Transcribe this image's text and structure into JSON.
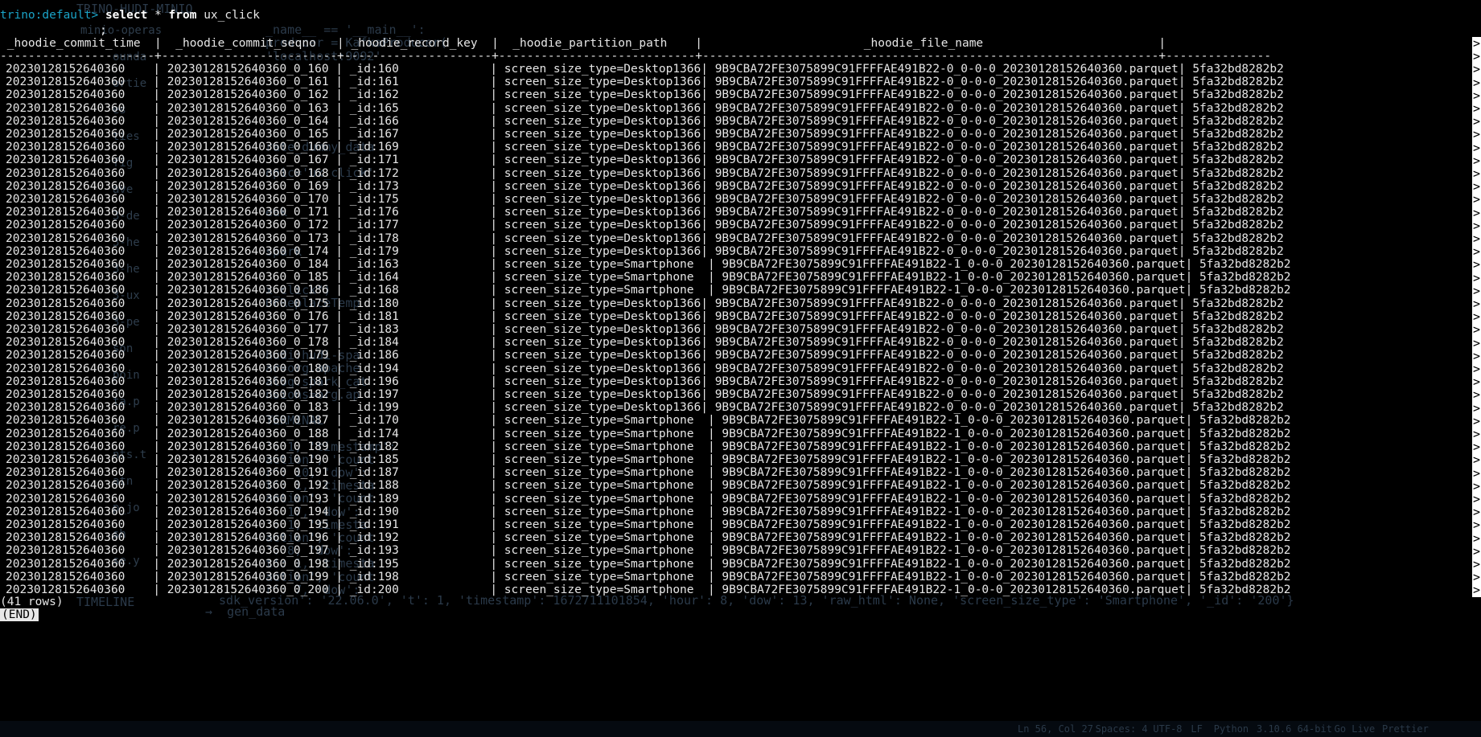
{
  "query": {
    "prompt_tag": "trino:default>",
    "keyword_select": "select",
    "rest": "* ",
    "keyword_from": "from",
    "table": "ux_click",
    "terminator": ";"
  },
  "table": {
    "header": [
      "_hoodie_commit_time",
      "_hoodie_commit_seqno",
      "_hoodie_record_key",
      "_hoodie_partition_path",
      "_hoodie_file_name"
    ],
    "header_line": " _hoodie_commit_time  |  _hoodie_commit_seqno   | _hoodie_record_key  |  _hoodie_partition_path    |                       _hoodie_file_name                         |",
    "separator_line": "----------------------+-------------------------+---------------------+----------------------------+-----------------------------------------------------------------+---------------",
    "rows": [
      [
        "20230128152640360",
        "20230128152640360_0_160",
        "_id:160",
        "screen_size_type=Desktop1366",
        "9B9CBA72FE3075899C91FFFFAE491B22-0_0-0-0_20230128152640360.parquet",
        "5fa32bd8282b2"
      ],
      [
        "20230128152640360",
        "20230128152640360_0_161",
        "_id:161",
        "screen_size_type=Desktop1366",
        "9B9CBA72FE3075899C91FFFFAE491B22-0_0-0-0_20230128152640360.parquet",
        "5fa32bd8282b2"
      ],
      [
        "20230128152640360",
        "20230128152640360_0_162",
        "_id:162",
        "screen_size_type=Desktop1366",
        "9B9CBA72FE3075899C91FFFFAE491B22-0_0-0-0_20230128152640360.parquet",
        "5fa32bd8282b2"
      ],
      [
        "20230128152640360",
        "20230128152640360_0_163",
        "_id:165",
        "screen_size_type=Desktop1366",
        "9B9CBA72FE3075899C91FFFFAE491B22-0_0-0-0_20230128152640360.parquet",
        "5fa32bd8282b2"
      ],
      [
        "20230128152640360",
        "20230128152640360_0_164",
        "_id:166",
        "screen_size_type=Desktop1366",
        "9B9CBA72FE3075899C91FFFFAE491B22-0_0-0-0_20230128152640360.parquet",
        "5fa32bd8282b2"
      ],
      [
        "20230128152640360",
        "20230128152640360_0_165",
        "_id:167",
        "screen_size_type=Desktop1366",
        "9B9CBA72FE3075899C91FFFFAE491B22-0_0-0-0_20230128152640360.parquet",
        "5fa32bd8282b2"
      ],
      [
        "20230128152640360",
        "20230128152640360_0_166",
        "_id:169",
        "screen_size_type=Desktop1366",
        "9B9CBA72FE3075899C91FFFFAE491B22-0_0-0-0_20230128152640360.parquet",
        "5fa32bd8282b2"
      ],
      [
        "20230128152640360",
        "20230128152640360_0_167",
        "_id:171",
        "screen_size_type=Desktop1366",
        "9B9CBA72FE3075899C91FFFFAE491B22-0_0-0-0_20230128152640360.parquet",
        "5fa32bd8282b2"
      ],
      [
        "20230128152640360",
        "20230128152640360_0_168",
        "_id:172",
        "screen_size_type=Desktop1366",
        "9B9CBA72FE3075899C91FFFFAE491B22-0_0-0-0_20230128152640360.parquet",
        "5fa32bd8282b2"
      ],
      [
        "20230128152640360",
        "20230128152640360_0_169",
        "_id:173",
        "screen_size_type=Desktop1366",
        "9B9CBA72FE3075899C91FFFFAE491B22-0_0-0-0_20230128152640360.parquet",
        "5fa32bd8282b2"
      ],
      [
        "20230128152640360",
        "20230128152640360_0_170",
        "_id:175",
        "screen_size_type=Desktop1366",
        "9B9CBA72FE3075899C91FFFFAE491B22-0_0-0-0_20230128152640360.parquet",
        "5fa32bd8282b2"
      ],
      [
        "20230128152640360",
        "20230128152640360_0_171",
        "_id:176",
        "screen_size_type=Desktop1366",
        "9B9CBA72FE3075899C91FFFFAE491B22-0_0-0-0_20230128152640360.parquet",
        "5fa32bd8282b2"
      ],
      [
        "20230128152640360",
        "20230128152640360_0_172",
        "_id:177",
        "screen_size_type=Desktop1366",
        "9B9CBA72FE3075899C91FFFFAE491B22-0_0-0-0_20230128152640360.parquet",
        "5fa32bd8282b2"
      ],
      [
        "20230128152640360",
        "20230128152640360_0_173",
        "_id:178",
        "screen_size_type=Desktop1366",
        "9B9CBA72FE3075899C91FFFFAE491B22-0_0-0-0_20230128152640360.parquet",
        "5fa32bd8282b2"
      ],
      [
        "20230128152640360",
        "20230128152640360_0_174",
        "_id:179",
        "screen_size_type=Desktop1366",
        "9B9CBA72FE3075899C91FFFFAE491B22-0_0-0-0_20230128152640360.parquet",
        "5fa32bd8282b2"
      ],
      [
        "20230128152640360",
        "20230128152640360_0_184",
        "_id:163",
        "screen_size_type=Smartphone  ",
        "9B9CBA72FE3075899C91FFFFAE491B22-1_0-0-0_20230128152640360.parquet",
        "5fa32bd8282b2"
      ],
      [
        "20230128152640360",
        "20230128152640360_0_185",
        "_id:164",
        "screen_size_type=Smartphone  ",
        "9B9CBA72FE3075899C91FFFFAE491B22-1_0-0-0_20230128152640360.parquet",
        "5fa32bd8282b2"
      ],
      [
        "20230128152640360",
        "20230128152640360_0_186",
        "_id:168",
        "screen_size_type=Smartphone  ",
        "9B9CBA72FE3075899C91FFFFAE491B22-1_0-0-0_20230128152640360.parquet",
        "5fa32bd8282b2"
      ],
      [
        "20230128152640360",
        "20230128152640360_0_175",
        "_id:180",
        "screen_size_type=Desktop1366",
        "9B9CBA72FE3075899C91FFFFAE491B22-0_0-0-0_20230128152640360.parquet",
        "5fa32bd8282b2"
      ],
      [
        "20230128152640360",
        "20230128152640360_0_176",
        "_id:181",
        "screen_size_type=Desktop1366",
        "9B9CBA72FE3075899C91FFFFAE491B22-0_0-0-0_20230128152640360.parquet",
        "5fa32bd8282b2"
      ],
      [
        "20230128152640360",
        "20230128152640360_0_177",
        "_id:183",
        "screen_size_type=Desktop1366",
        "9B9CBA72FE3075899C91FFFFAE491B22-0_0-0-0_20230128152640360.parquet",
        "5fa32bd8282b2"
      ],
      [
        "20230128152640360",
        "20230128152640360_0_178",
        "_id:184",
        "screen_size_type=Desktop1366",
        "9B9CBA72FE3075899C91FFFFAE491B22-0_0-0-0_20230128152640360.parquet",
        "5fa32bd8282b2"
      ],
      [
        "20230128152640360",
        "20230128152640360_0_179",
        "_id:186",
        "screen_size_type=Desktop1366",
        "9B9CBA72FE3075899C91FFFFAE491B22-0_0-0-0_20230128152640360.parquet",
        "5fa32bd8282b2"
      ],
      [
        "20230128152640360",
        "20230128152640360_0_180",
        "_id:194",
        "screen_size_type=Desktop1366",
        "9B9CBA72FE3075899C91FFFFAE491B22-0_0-0-0_20230128152640360.parquet",
        "5fa32bd8282b2"
      ],
      [
        "20230128152640360",
        "20230128152640360_0_181",
        "_id:196",
        "screen_size_type=Desktop1366",
        "9B9CBA72FE3075899C91FFFFAE491B22-0_0-0-0_20230128152640360.parquet",
        "5fa32bd8282b2"
      ],
      [
        "20230128152640360",
        "20230128152640360_0_182",
        "_id:197",
        "screen_size_type=Desktop1366",
        "9B9CBA72FE3075899C91FFFFAE491B22-0_0-0-0_20230128152640360.parquet",
        "5fa32bd8282b2"
      ],
      [
        "20230128152640360",
        "20230128152640360_0_183",
        "_id:199",
        "screen_size_type=Desktop1366",
        "9B9CBA72FE3075899C91FFFFAE491B22-0_0-0-0_20230128152640360.parquet",
        "5fa32bd8282b2"
      ],
      [
        "20230128152640360",
        "20230128152640360_0_187",
        "_id:170",
        "screen_size_type=Smartphone  ",
        "9B9CBA72FE3075899C91FFFFAE491B22-1_0-0-0_20230128152640360.parquet",
        "5fa32bd8282b2"
      ],
      [
        "20230128152640360",
        "20230128152640360_0_188",
        "_id:174",
        "screen_size_type=Smartphone  ",
        "9B9CBA72FE3075899C91FFFFAE491B22-1_0-0-0_20230128152640360.parquet",
        "5fa32bd8282b2"
      ],
      [
        "20230128152640360",
        "20230128152640360_0_189",
        "_id:182",
        "screen_size_type=Smartphone  ",
        "9B9CBA72FE3075899C91FFFFAE491B22-1_0-0-0_20230128152640360.parquet",
        "5fa32bd8282b2"
      ],
      [
        "20230128152640360",
        "20230128152640360_0_190",
        "_id:185",
        "screen_size_type=Smartphone  ",
        "9B9CBA72FE3075899C91FFFFAE491B22-1_0-0-0_20230128152640360.parquet",
        "5fa32bd8282b2"
      ],
      [
        "20230128152640360",
        "20230128152640360_0_191",
        "_id:187",
        "screen_size_type=Smartphone  ",
        "9B9CBA72FE3075899C91FFFFAE491B22-1_0-0-0_20230128152640360.parquet",
        "5fa32bd8282b2"
      ],
      [
        "20230128152640360",
        "20230128152640360_0_192",
        "_id:188",
        "screen_size_type=Smartphone  ",
        "9B9CBA72FE3075899C91FFFFAE491B22-1_0-0-0_20230128152640360.parquet",
        "5fa32bd8282b2"
      ],
      [
        "20230128152640360",
        "20230128152640360_0_193",
        "_id:189",
        "screen_size_type=Smartphone  ",
        "9B9CBA72FE3075899C91FFFFAE491B22-1_0-0-0_20230128152640360.parquet",
        "5fa32bd8282b2"
      ],
      [
        "20230128152640360",
        "20230128152640360_0_194",
        "_id:190",
        "screen_size_type=Smartphone  ",
        "9B9CBA72FE3075899C91FFFFAE491B22-1_0-0-0_20230128152640360.parquet",
        "5fa32bd8282b2"
      ],
      [
        "20230128152640360",
        "20230128152640360_0_195",
        "_id:191",
        "screen_size_type=Smartphone  ",
        "9B9CBA72FE3075899C91FFFFAE491B22-1_0-0-0_20230128152640360.parquet",
        "5fa32bd8282b2"
      ],
      [
        "20230128152640360",
        "20230128152640360_0_196",
        "_id:192",
        "screen_size_type=Smartphone  ",
        "9B9CBA72FE3075899C91FFFFAE491B22-1_0-0-0_20230128152640360.parquet",
        "5fa32bd8282b2"
      ],
      [
        "20230128152640360",
        "20230128152640360_0_197",
        "_id:193",
        "screen_size_type=Smartphone  ",
        "9B9CBA72FE3075899C91FFFFAE491B22-1_0-0-0_20230128152640360.parquet",
        "5fa32bd8282b2"
      ],
      [
        "20230128152640360",
        "20230128152640360_0_198",
        "_id:195",
        "screen_size_type=Smartphone  ",
        "9B9CBA72FE3075899C91FFFFAE491B22-1_0-0-0_20230128152640360.parquet",
        "5fa32bd8282b2"
      ],
      [
        "20230128152640360",
        "20230128152640360_0_199",
        "_id:198",
        "screen_size_type=Smartphone  ",
        "9B9CBA72FE3075899C91FFFFAE491B22-1_0-0-0_20230128152640360.parquet",
        "5fa32bd8282b2"
      ],
      [
        "20230128152640360",
        "20230128152640360_0_200",
        "_id:200",
        "screen_size_type=Smartphone  ",
        "9B9CBA72FE3075899C91FFFFAE491B22-1_0-0-0_20230128152640360.parquet",
        "5fa32bd8282b2"
      ]
    ],
    "overflow_marker": ">"
  },
  "footer": {
    "row_count": "(41 rows)",
    "end_tag": "(END)"
  },
  "background_editor": {
    "lines": [
      {
        "text": "_name__ == '__main__':",
        "row": 1
      },
      {
        "text": "producer = KafkaProducer(",
        "row": 2
      },
      {
        "text": "'localhost:9092'",
        "row": 3
      },
      {
        "text": "rate_dummy_data",
        "row": 10
      },
      {
        "text": "opic='ux_click'",
        "row": 12
      },
      {
        "text": "eak",
        "row": 15
      },
      {
        "text": "spark",
        "row": 18
      },
      {
        "text": "x_click\")",
        "row": 21
      },
      {
        "text": "OrReplaceTemp",
        "row": 22
      },
      {
        "text": "hudi:hudi-spa",
        "row": 26
      },
      {
        "text": "ar=org.apache",
        "row": 27
      },
      {
        "text": "alog.spark_cat",
        "row": 28
      },
      {
        "text": "nsions=org.ap",
        "row": 29
      },
      {
        "text": "TERMINAL",
        "row": 31
      },
      {
        "text": "': 1, 'timestamp': ",
        "row": 33
      },
      {
        "text": "action', 'count",
        "row": 34
      },
      {
        "text": "r': 10, 'dow': ",
        "row": 35
      },
      {
        "text": "t': 1, 'timesta",
        "row": 36
      },
      {
        "text": "action', 'count",
        "row": 37
      },
      {
        "text": "': 17, 'dow': ",
        "row": 38
      },
      {
        "text": "': 1, 'timesta",
        "row": 39
      },
      {
        "text": "action', 'count",
        "row": 40
      },
      {
        "text": "': 8, 'dow': ",
        "row": 41
      },
      {
        "text": "t': 1, 'timesta",
        "row": 42
      },
      {
        "text": "action', 'count",
        "row": 43
      },
      {
        "text": "r': 7, 'dow': ",
        "row": 44
      }
    ],
    "bottom_line": "sdk_version': '22.06.0', 't': 1, 'timestamp': 1672711101854, 'hour': 8, 'dow': 13, 'raw_html': None, 'screen_size_type': 'Smartphone', '_id': '200'}",
    "prompt_line": "→  gen_data",
    "sidebar": [
      "minio-operas",
      "ounda",
      "ortie",
      "es",
      "ties",
      "fig",
      "ave",
      "3-de",
      "3-he",
      "3-he",
      "3-ux",
      "3-pe",
      "son",
      "poin",
      "ta.p",
      "re.p",
      "nts.t",
      "atn",
      "p_jo",
      "sh",
      "se.y"
    ],
    "sidebar_title": "TRINO-HUDI-MINIO",
    "sidebar_timeline": "TIMELINE",
    "status_items": [
      "Ln 56, Col 27",
      "Spaces: 4",
      "UTF-8",
      "LF",
      "Python",
      "3.10.6 64-bit",
      "Go Live",
      "Prettier"
    ]
  },
  "colors": {
    "background": "#000000",
    "text": "#e6e6e6",
    "prompt": "#1aa3c7",
    "ghost": "#2b3a4a"
  }
}
